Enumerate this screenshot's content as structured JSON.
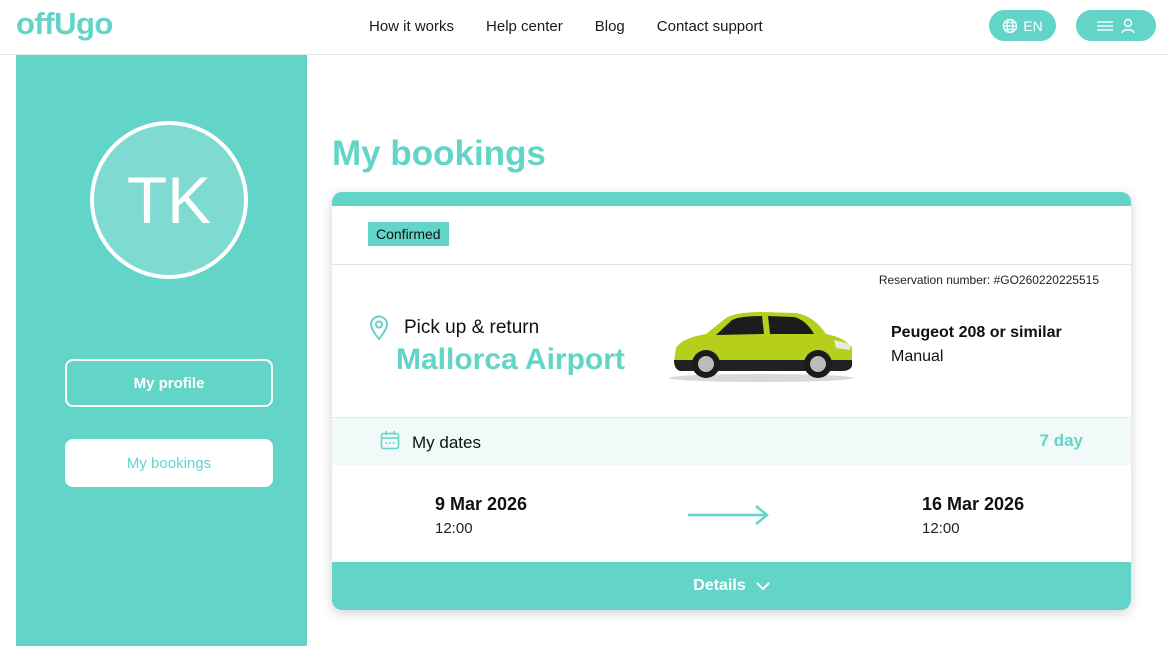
{
  "brand": {
    "logo_text": "offUgo",
    "accent_color": "#62d4c8"
  },
  "nav": {
    "items": [
      "How it works",
      "Help center",
      "Blog",
      "Contact support"
    ]
  },
  "header": {
    "language": "EN",
    "globe_icon": "globe-icon",
    "menu_icon": "hamburger-menu-icon",
    "user_icon": "user-icon"
  },
  "sidebar": {
    "avatar_initials": "TK",
    "my_profile": "My profile",
    "my_bookings": "My bookings"
  },
  "main": {
    "title": "My bookings",
    "booking": {
      "status": "Confirmed",
      "reservation": "Reservation number: #GO260220225515",
      "pickup_label": "Pick up & return",
      "location": "Mallorca Airport",
      "car_name": "Peugeot 208 or similar",
      "transmission": "Manual",
      "dates_label": "My dates",
      "duration": "7 day",
      "start_date": "9 Mar 2026",
      "start_time": "12:00",
      "end_date": "16 Mar 2026",
      "end_time": "12:00",
      "details_label": "Details"
    }
  }
}
